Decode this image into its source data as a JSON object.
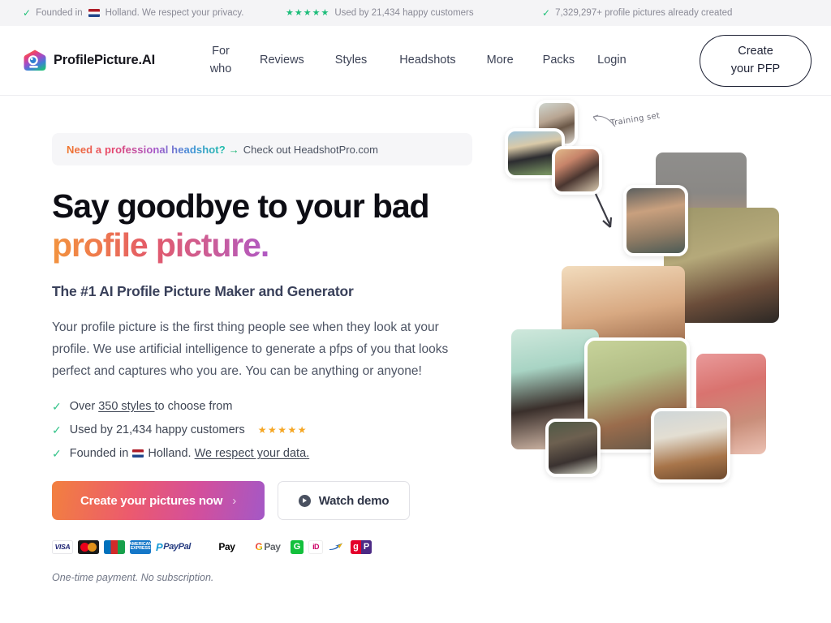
{
  "topbar": {
    "items": [
      {
        "icon": "check-icon",
        "text_before": "Founded in",
        "flag": "nl-flag-icon",
        "text_after": "Holland. We respect your privacy."
      },
      {
        "icon": "stars-icon",
        "stars": "★★★★★",
        "text": "Used by 21,434 happy customers"
      },
      {
        "icon": "check-icon",
        "text": "7,329,297+ profile pictures already created"
      }
    ]
  },
  "nav": {
    "brand": "ProfilePicture.AI",
    "logo_icon": "profilepicture-logo-icon",
    "links": [
      {
        "label": "For who",
        "line1": "For",
        "line2": "who"
      },
      {
        "label": "Reviews"
      },
      {
        "label": "Styles"
      },
      {
        "label": "Headshots"
      },
      {
        "label": "More"
      },
      {
        "label": "Packs"
      },
      {
        "label": "Login"
      }
    ],
    "cta": {
      "line1": "Create",
      "line2": "your PFP"
    }
  },
  "hero": {
    "promo": {
      "strong": "Need a professional headshot?",
      "arrow": "→",
      "rest": "Check out HeadshotPro.com"
    },
    "headline_line1": "Say goodbye to your bad",
    "headline_line2": "profile picture.",
    "subheadline": "The #1 AI Profile Picture Maker and Generator",
    "lede": "Your profile picture is the first thing people see when they look at your profile. We use artificial intelligence to generate a pfps of you that looks perfect and captures who you are. You can be anything or anyone!",
    "features": [
      {
        "check": "check-icon",
        "pre": "Over ",
        "link": "350 styles ",
        "post": "to choose from"
      },
      {
        "check": "check-icon",
        "pre": "Used by 21,434 happy customers",
        "stars": "★★★★★"
      },
      {
        "check": "check-icon",
        "pre": "Founded in ",
        "flag": "nl-flag-icon",
        "mid": " Holland. ",
        "link": "We respect your data."
      }
    ],
    "cta_primary": "Create your pictures now",
    "cta_primary_chevron": "›",
    "cta_secondary": "Watch demo",
    "payments": [
      {
        "name": "visa",
        "label": "VISA"
      },
      {
        "name": "mastercard",
        "label": ""
      },
      {
        "name": "jcb",
        "label": "JCB"
      },
      {
        "name": "amex",
        "label": "AMERICAN EXPRESS"
      },
      {
        "name": "paypal",
        "label": "PayPal"
      },
      {
        "name": "apple-pay",
        "label": "Pay"
      },
      {
        "name": "google-pay",
        "label": "Pay"
      },
      {
        "name": "giropay",
        "label": "G"
      },
      {
        "name": "ideal",
        "label": "iD"
      },
      {
        "name": "sofort",
        "label": ""
      },
      {
        "name": "giropay-paydirekt",
        "label": "gP"
      }
    ],
    "fineprint": "One-time payment. No subscription.",
    "collage_annotation": "Training set"
  },
  "colors": {
    "accent_orange": "#f2803f",
    "accent_pink": "#ec5a6e",
    "accent_purple": "#a458c6",
    "green": "#21c17a",
    "star_amber": "#f5a623",
    "dark": "#1e2235"
  }
}
